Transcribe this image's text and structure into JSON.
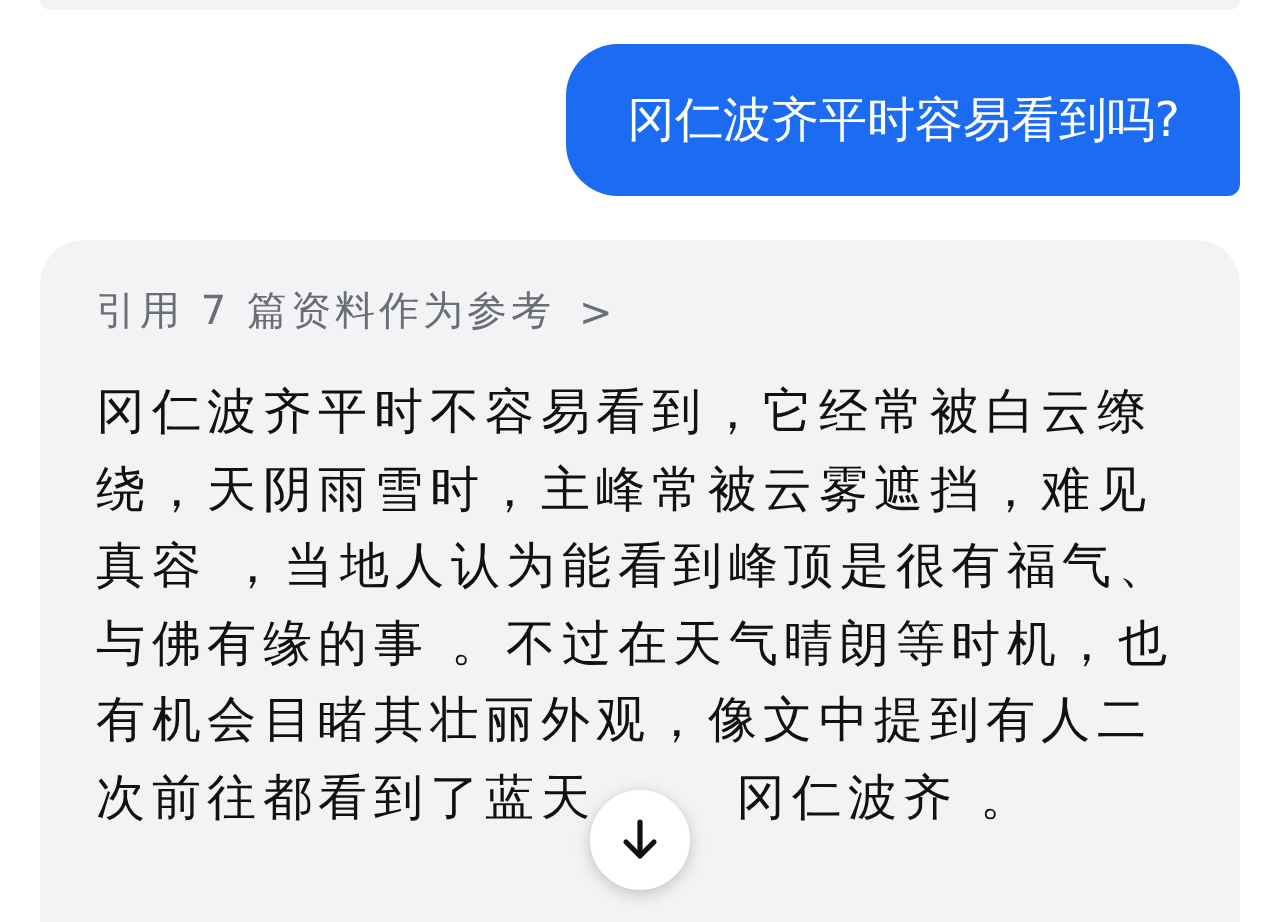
{
  "user_message": "冈仁波齐平时容易看到吗?",
  "answer": {
    "sources": "引用 7 篇资料作为参考",
    "sources_chevron": ">",
    "text": "冈仁波齐平时不容易看到，它经常被白云缭绕，天阴雨雪时，主峰常被云雾遮挡，难见真容 ，当地人认为能看到峰顶是很有福气、与佛有缘的事 。不过在天气晴朗等时机，也有机会目睹其壮丽外观，像文中提到有人二次前往都看到了蓝天",
    "text_tail": "冈仁波齐 。"
  }
}
